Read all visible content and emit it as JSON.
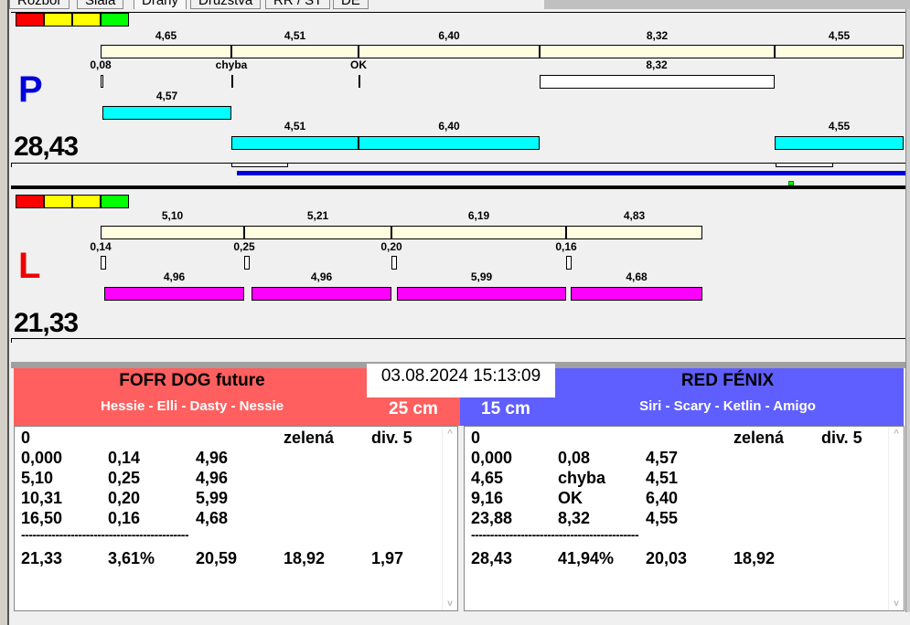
{
  "tabs": [
    "Rozbor",
    "Siala",
    "Dráhy",
    "Družstva",
    "RR / ST",
    "DE"
  ],
  "colors": {
    "red": "#ff0000",
    "yellow": "#ffff00",
    "green": "#00ff00",
    "cream": "#fffde0",
    "cyan": "#00ffff",
    "magenta": "#ff00ff",
    "left_team": "#ff5f5f",
    "right_team": "#5f5fff",
    "lane_p": "#0000dd",
    "lane_l": "#ee0000"
  },
  "lane_p": {
    "letter": "P",
    "total": "28,43",
    "top": [
      "4,65",
      "4,51",
      "6,40",
      "8,32",
      "4,55"
    ],
    "mid": [
      "0,08",
      "chyba",
      "OK",
      "8,32"
    ],
    "cyan1": [
      "4,57"
    ],
    "cyan2": [
      "4,51",
      "6,40",
      "4,55"
    ]
  },
  "lane_l": {
    "letter": "L",
    "total": "21,33",
    "top": [
      "5,10",
      "5,21",
      "6,19",
      "4,83"
    ],
    "mid": [
      "0,14",
      "0,25",
      "0,20",
      "0,16"
    ],
    "mag": [
      "4,96",
      "4,96",
      "5,99",
      "4,68"
    ]
  },
  "datetime": "03.08.2024 15:13:09",
  "left_team": {
    "name": "FOFR DOG future",
    "dogs": "Hessie - Elli - Dasty - Nessie",
    "distance": "25 cm",
    "rows": [
      [
        "0",
        "",
        "",
        "zelená",
        "div. 5"
      ],
      [
        "0,000",
        "0,14",
        "4,96",
        "",
        ""
      ],
      [
        "5,10",
        "0,25",
        "4,96",
        "",
        ""
      ],
      [
        "10,31",
        "0,20",
        "5,99",
        "",
        ""
      ],
      [
        "16,50",
        "0,16",
        "4,68",
        "",
        ""
      ]
    ],
    "separator": "--------------------------------------------",
    "totals": [
      "21,33",
      "3,61%",
      "20,59",
      "18,92",
      "1,97"
    ]
  },
  "right_team": {
    "name": "RED FÉNIX",
    "dogs": "Siri - Scary - Ketlin - Amigo",
    "distance": "15 cm",
    "rows": [
      [
        "0",
        "",
        "",
        "zelená",
        "div. 5"
      ],
      [
        "0,000",
        "0,08",
        "4,57",
        "",
        ""
      ],
      [
        "4,65",
        "chyba",
        "4,51",
        "",
        ""
      ],
      [
        "9,16",
        "OK",
        "6,40",
        "",
        ""
      ],
      [
        "23,88",
        "8,32",
        "4,55",
        "",
        ""
      ]
    ],
    "separator": "--------------------------------------------",
    "totals": [
      "28,43",
      "41,94%",
      "20,03",
      "18,92",
      ""
    ]
  },
  "scroll": {
    "up": "^",
    "down": "v"
  }
}
